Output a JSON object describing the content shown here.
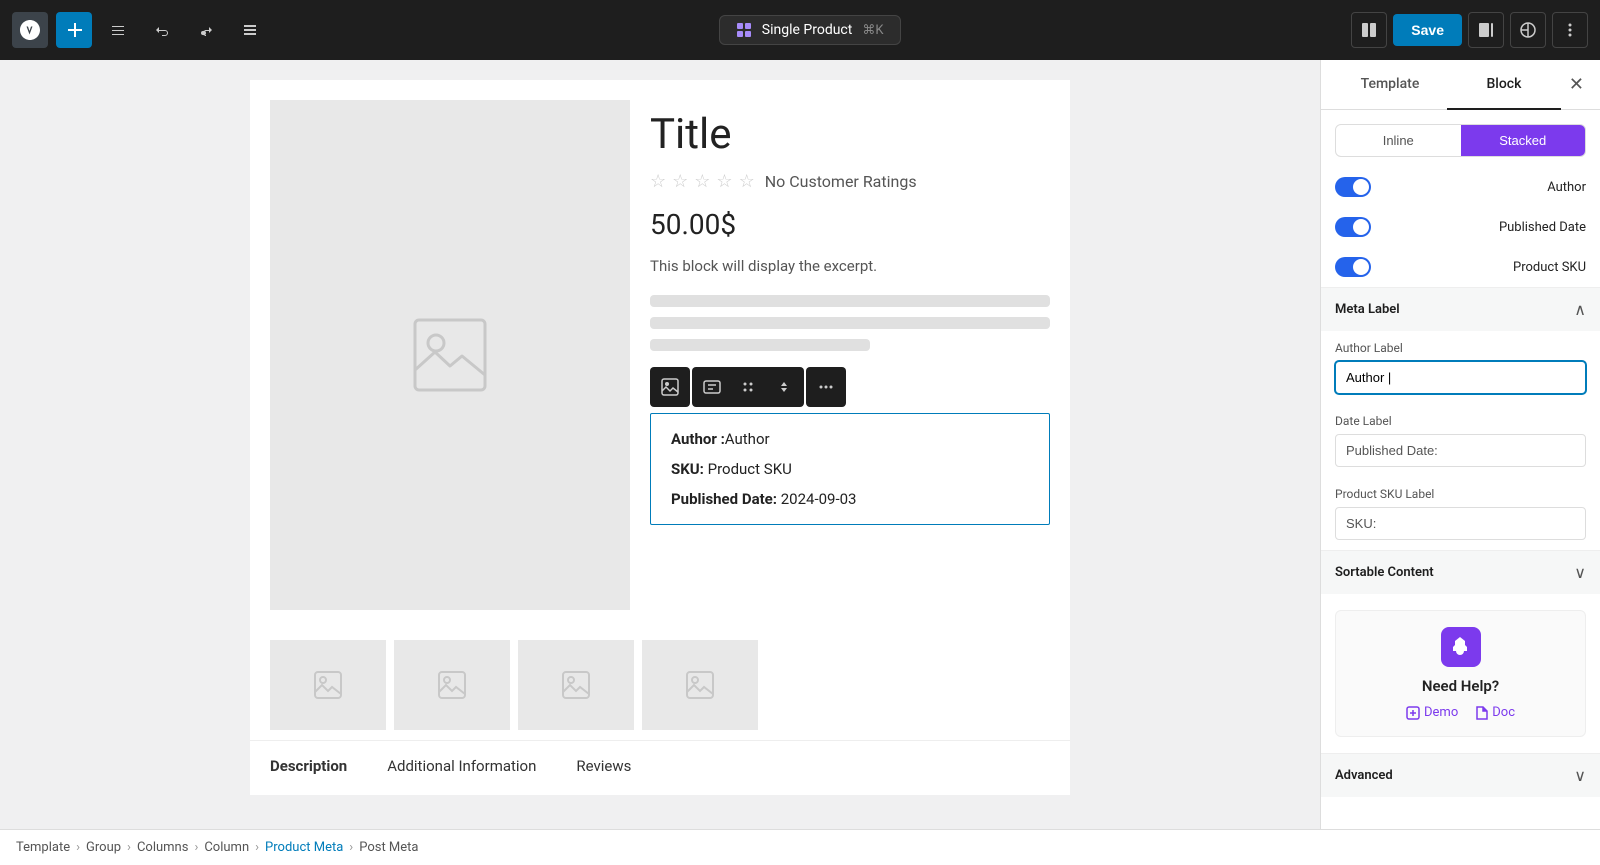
{
  "topbar": {
    "save_label": "Save",
    "breadcrumb": {
      "icon": "layout-icon",
      "text": "Single Product",
      "shortcut": "⌘K"
    }
  },
  "product": {
    "title": "Title",
    "ratings_text": "No Customer Ratings",
    "price": "50.00$",
    "excerpt": "This block will display the excerpt.",
    "tabs": [
      "Description",
      "Additional Information",
      "Reviews"
    ]
  },
  "meta_content": {
    "author_row": "Author :",
    "author_value": "Author",
    "sku_label": "SKU:",
    "sku_value": "Product SKU",
    "date_label": "Published Date:",
    "date_value": "2024-09-03"
  },
  "right_panel": {
    "tab_template": "Template",
    "tab_block": "Block",
    "active_tab": "Block",
    "layout_inline": "Inline",
    "layout_stacked": "Stacked",
    "active_layout": "Stacked",
    "toggles": [
      {
        "label": "Author",
        "enabled": true
      },
      {
        "label": "Published Date",
        "enabled": true
      },
      {
        "label": "Product SKU",
        "enabled": true
      }
    ],
    "meta_label_section": "Meta Label",
    "author_label_field": "Author Label",
    "author_label_value": "Author |",
    "date_label_field": "Date Label",
    "date_label_value": "Published Date:",
    "sku_label_field": "Product SKU Label",
    "sku_label_value": "SKU:",
    "sortable_content": "Sortable Content",
    "need_help_title": "Need Help?",
    "demo_label": "Demo",
    "doc_label": "Doc",
    "advanced_label": "Advanced"
  },
  "breadcrumb": {
    "items": [
      "Template",
      "Group",
      "Columns",
      "Column",
      "Product Meta",
      "Post Meta"
    ]
  }
}
